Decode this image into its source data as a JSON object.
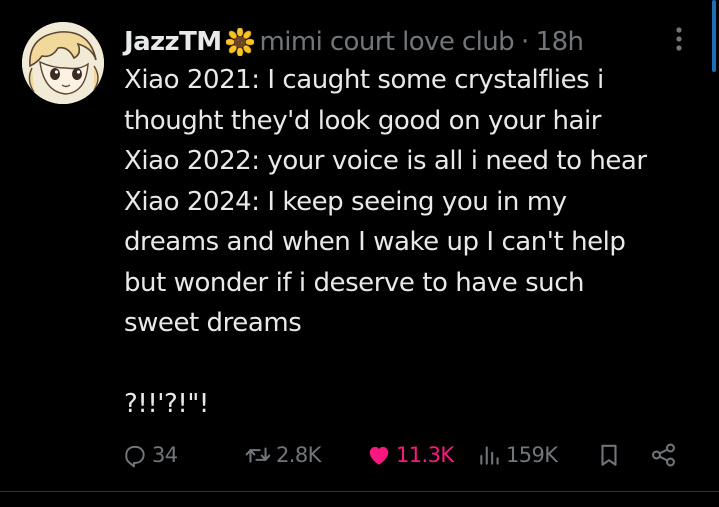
{
  "tweet": {
    "display_name": "JazzTM",
    "badge_icon": "sunflower-icon",
    "handle": "mimi court love club",
    "separator": "·",
    "time": "18h",
    "text_lines": [
      "Xiao 2021: I caught some crystalflies i",
      "thought they'd look good on your hair",
      "Xiao 2022: your voice is all i need to hear",
      "Xiao 2024: I keep seeing you in my",
      "dreams and when I wake up I can't help",
      "but wonder if i deserve to have such",
      "sweet dreams",
      "",
      "?!!'?!\"!"
    ]
  },
  "actions": {
    "reply": {
      "icon": "reply-icon",
      "count": "34"
    },
    "repost": {
      "icon": "repost-icon",
      "count": "2.8K"
    },
    "like": {
      "icon": "heart-icon",
      "count": "11.3K",
      "liked": true
    },
    "views": {
      "icon": "views-icon",
      "count": "159K"
    },
    "bookmark": {
      "icon": "bookmark-icon"
    },
    "share": {
      "icon": "share-icon"
    }
  },
  "colors": {
    "background": "#000000",
    "text": "#e7e9ea",
    "muted": "#71767b",
    "like": "#f91880"
  }
}
